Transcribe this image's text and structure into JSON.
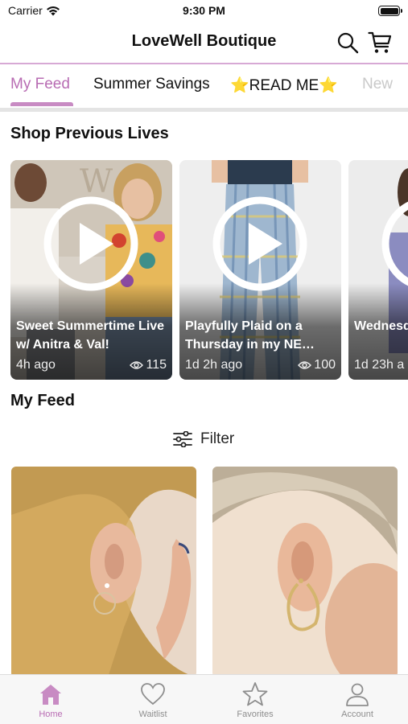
{
  "status_bar": {
    "carrier": "Carrier",
    "time": "9:30 PM"
  },
  "header": {
    "title": "LoveWell Boutique"
  },
  "tabs": [
    {
      "label": "My Feed",
      "active": true
    },
    {
      "label": "Summer Savings",
      "active": false
    },
    {
      "label": "⭐READ ME⭐",
      "active": false
    },
    {
      "label": "New",
      "active": false
    }
  ],
  "lives_section": {
    "title": "Shop Previous Lives",
    "cards": [
      {
        "title": "Sweet Summertime Live w/ Anitra & Val!",
        "age": "4h ago",
        "views": "115"
      },
      {
        "title": "Playfully Plaid on a Thursday in my NE…",
        "age": "1d 2h ago",
        "views": "100"
      },
      {
        "title": "Wednesday New Arr",
        "age": "1d 23h a",
        "views": ""
      }
    ]
  },
  "feed_section": {
    "title": "My Feed",
    "filter_label": "Filter"
  },
  "bottom_nav": [
    {
      "label": "Home",
      "icon": "home-icon",
      "active": true
    },
    {
      "label": "Waitlist",
      "icon": "heart-icon",
      "active": false
    },
    {
      "label": "Favorites",
      "icon": "star-icon",
      "active": false
    },
    {
      "label": "Account",
      "icon": "person-icon",
      "active": false
    }
  ],
  "colors": {
    "accent": "#b86cb3",
    "header_line": "#d7a9d5",
    "underline": "#c88bc3"
  }
}
